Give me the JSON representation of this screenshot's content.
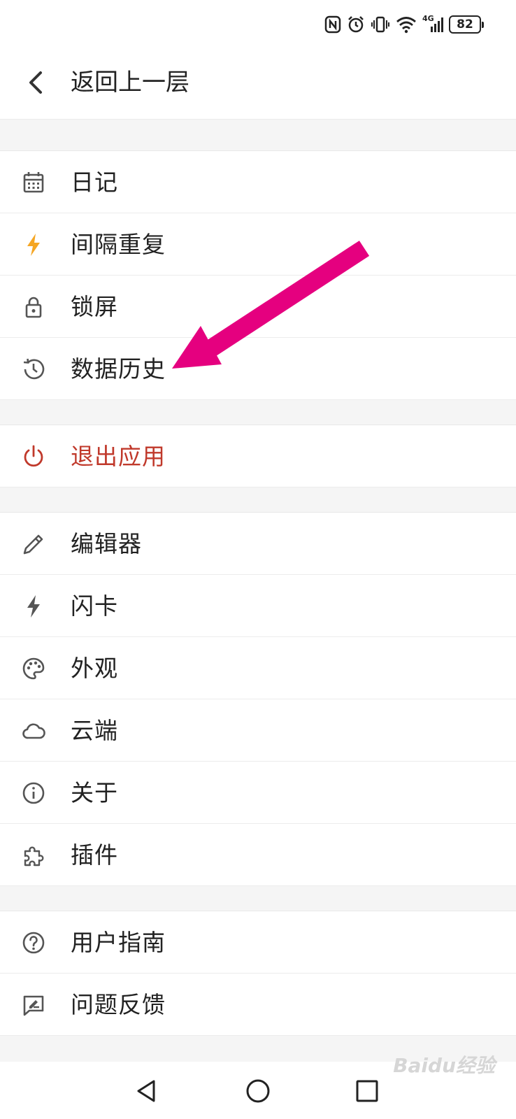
{
  "status_bar": {
    "network": "4G",
    "battery": "82",
    "icons": [
      "nfc-icon",
      "alarm-icon",
      "vibrate-icon",
      "wifi-icon",
      "signal-icon",
      "battery-icon"
    ]
  },
  "header": {
    "back_label": "返回上一层"
  },
  "groups": [
    [
      {
        "label": "日记",
        "icon": "calendar-icon"
      },
      {
        "label": "间隔重复",
        "icon": "lightning-icon",
        "accent": "#f5a623"
      },
      {
        "label": "锁屏",
        "icon": "lock-icon"
      },
      {
        "label": "数据历史",
        "icon": "history-icon"
      }
    ],
    [
      {
        "label": "退出应用",
        "icon": "power-icon",
        "accent": "#c0392b"
      }
    ],
    [
      {
        "label": "编辑器",
        "icon": "pencil-icon"
      },
      {
        "label": "闪卡",
        "icon": "flash-icon"
      },
      {
        "label": "外观",
        "icon": "palette-icon"
      },
      {
        "label": "云端",
        "icon": "cloud-icon"
      },
      {
        "label": "关于",
        "icon": "info-icon"
      },
      {
        "label": "插件",
        "icon": "puzzle-icon"
      }
    ],
    [
      {
        "label": "用户指南",
        "icon": "help-icon"
      },
      {
        "label": "问题反馈",
        "icon": "feedback-icon"
      }
    ]
  ],
  "annotation_arrow_color": "#e5007f",
  "nav_bar": {
    "icons": [
      "back-triangle-icon",
      "home-circle-icon",
      "recents-square-icon"
    ]
  },
  "watermark": "Baidu经验"
}
